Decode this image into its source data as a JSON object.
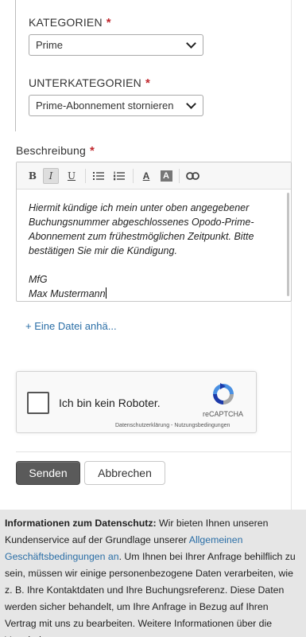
{
  "form": {
    "category": {
      "label": "KATEGORIEN",
      "required_mark": "*",
      "selected": "Prime"
    },
    "subcategory": {
      "label": "UNTERKATEGORIEN",
      "required_mark": "*",
      "selected": "Prime-Abonnement stornieren"
    },
    "description": {
      "label": "Beschreibung",
      "required_mark": "*",
      "toolbar": {
        "bold": "B",
        "italic": "I",
        "underline": "U",
        "text_color": "A",
        "bg_color": "A"
      },
      "text_paragraph": "Hiermit kündige ich mein unter oben angegebener Buchungsnummer abgeschlossenes Opodo-Prime-Abonnement zum frühestmöglichen Zeitpunkt. Bitte bestätigen Sie mir die Kündigung.",
      "text_greeting": "MfG",
      "text_name": "Max Mustermann"
    },
    "attach_file": "+ Eine Datei anhä...",
    "captcha": {
      "label": "Ich bin kein Roboter.",
      "brand": "reCAPTCHA",
      "links": "Datenschutzerklärung - Nutzungsbedingungen"
    },
    "send_button": "Senden",
    "cancel_button": "Abbrechen"
  },
  "privacy": {
    "heading": "Informationen zum Datenschutz:",
    "text_before_link": " Wir bieten Ihnen unseren Kundenservice auf der Grundlage unserer ",
    "link": "Allgemeinen Geschäftsbedingungen an",
    "text_after_link": ". Um Ihnen bei Ihrer Anfrage behilflich zu sein, müssen wir einige personenbezogene Daten verarbeiten, wie z. B. Ihre Kontaktdaten und Ihre Buchungsreferenz. Diese Daten werden sicher behandelt, um Ihre Anfrage in Bezug auf Ihren Vertrag mit uns zu bearbeiten. Weitere Informationen über die Verarbeitung ..."
  },
  "colors": {
    "required": "#c0272d",
    "link": "#2a6ea6",
    "send_button_bg": "#5a5a5a",
    "privacy_bg": "#e6e6e6"
  }
}
